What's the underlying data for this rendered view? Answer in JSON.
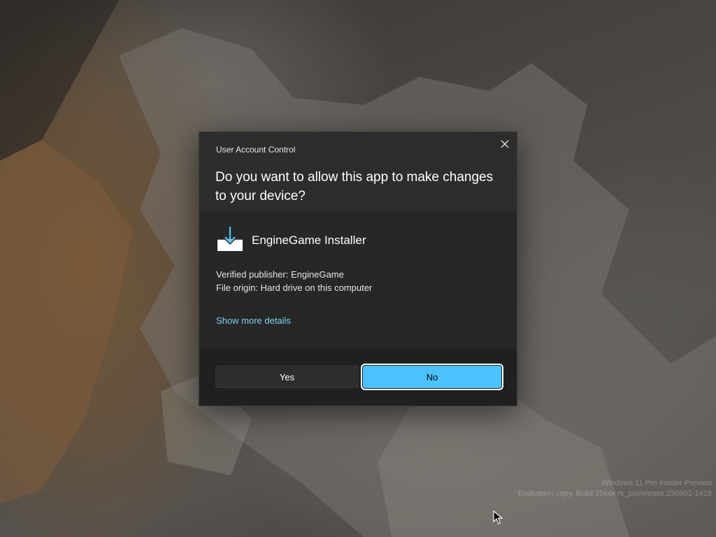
{
  "dialog": {
    "window_title": "User Account Control",
    "question": "Do you want to allow this app to make changes to your device?",
    "app_name": "EngineGame Installer",
    "publisher": "Verified publisher: EngineGame",
    "file_origin": "File origin: Hard drive on this computer",
    "details_link": "Show more details",
    "yes_label": "Yes",
    "no_label": "No",
    "close_icon": "close-icon",
    "app_icon": "installer-download-icon",
    "accent_color": "#4cc2ff",
    "link_color": "#7fd3f5"
  },
  "desktop": {
    "watermark_line1": "Windows 11 Pro Insider Preview",
    "watermark_line2": "Evaluation copy. Build 25xxx.rs_prerelease.230801-1416",
    "cursor_icon": "mouse-pointer-icon"
  }
}
